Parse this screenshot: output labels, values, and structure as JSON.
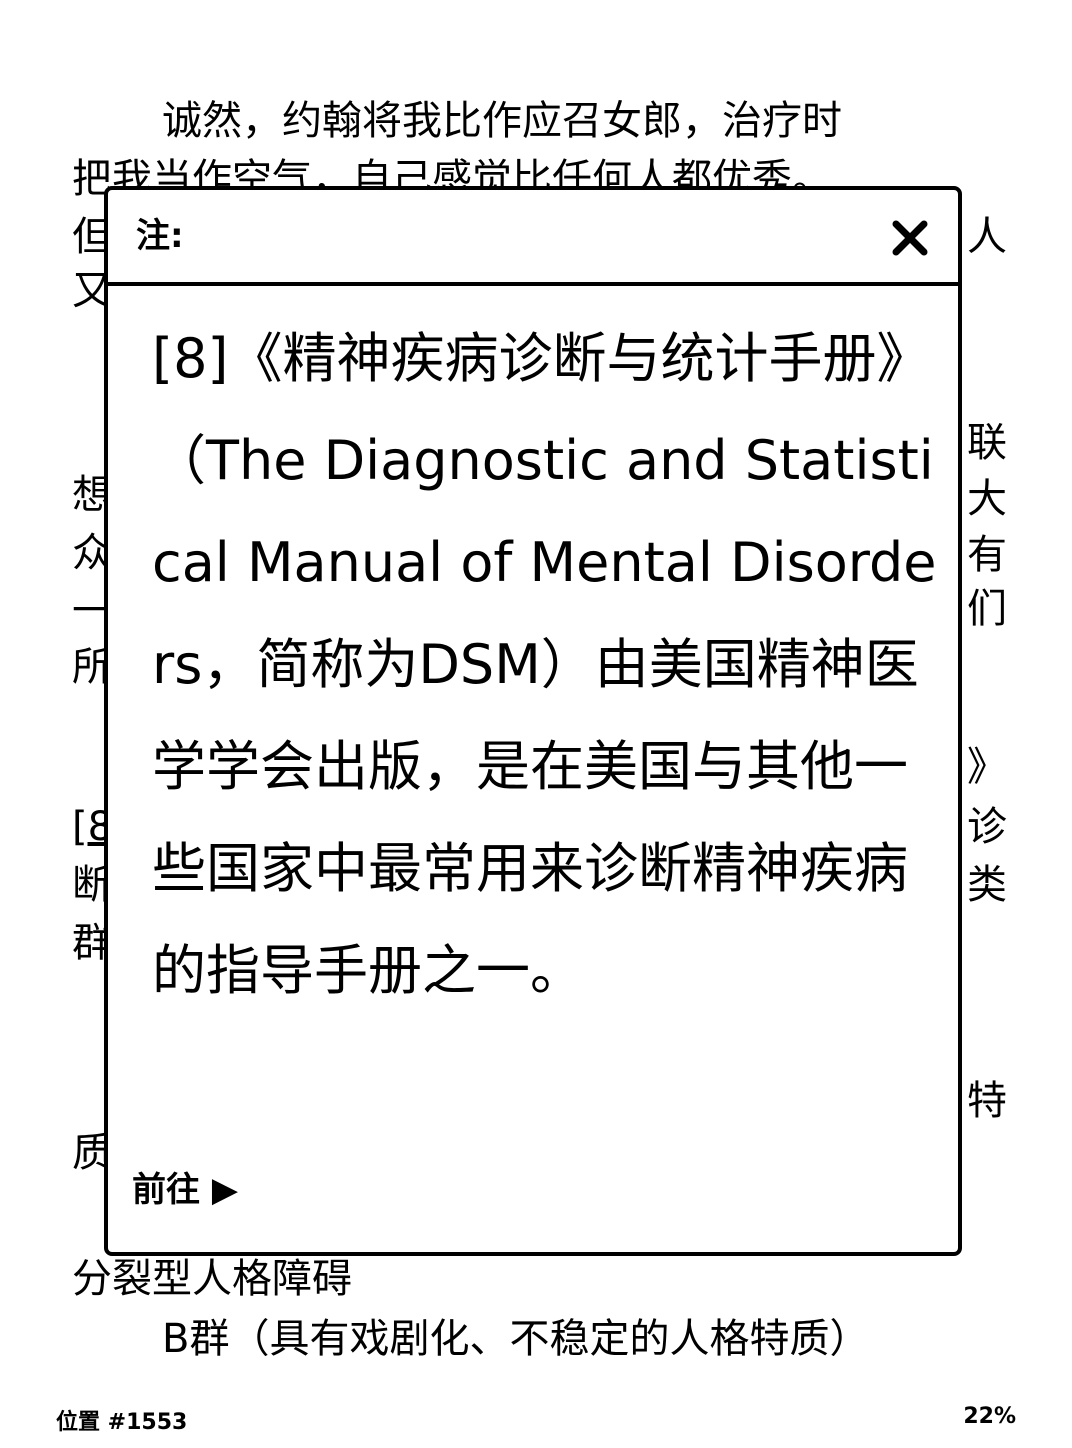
{
  "page": {
    "line1": "诚然，约翰将我比作应召女郎，治疗时",
    "line2": "把我当作空气，自己感觉比任何人都优秀。",
    "left_fragments": [
      "但",
      "又",
      "想",
      "众",
      "一",
      "所",
      "[8",
      "断",
      "群",
      "质"
    ],
    "right_fragments": [
      "人",
      "联",
      "大",
      "有",
      "们",
      "》",
      "诊",
      "类",
      "特"
    ],
    "line_bottom1": "分裂型人格障碍",
    "line_bottom2": "B群（具有戏剧化、不稳定的人格特质）"
  },
  "footer": {
    "location": "位置 #1553",
    "progress": "22%"
  },
  "popup": {
    "title": "注:",
    "body": "[8]《精神疾病诊断与统计手册》（The Diagnostic and Statistical Manual of Mental Disorders，简称为DSM）由美国精神医学学会出版，是在美国与其他一些国家中最常用来诊断精神疾病的指导手册之一。",
    "goto_label": "前往 ▶"
  },
  "icons": {
    "close": "close-icon"
  }
}
